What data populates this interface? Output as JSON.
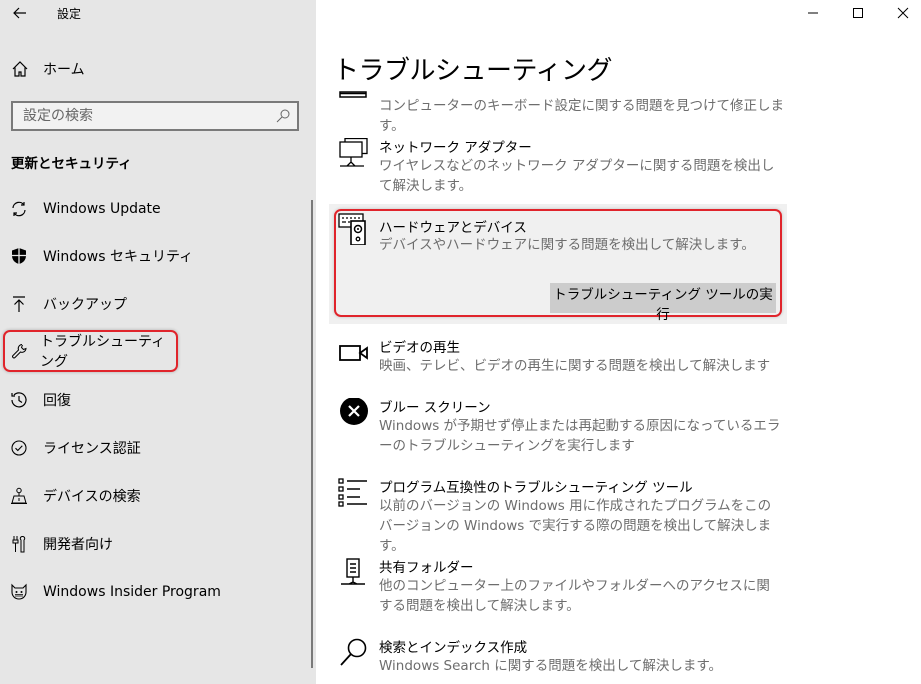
{
  "window": {
    "title": "設定",
    "controls": {
      "minimize_icon": "minimize-icon",
      "maximize_icon": "maximize-icon",
      "close_icon": "close-icon"
    }
  },
  "sidebar": {
    "home_label": "ホーム",
    "search_placeholder": "設定の検索",
    "section_heading": "更新とセキュリティ",
    "items": [
      {
        "label": "Windows Update",
        "icon": "sync-icon"
      },
      {
        "label": "Windows セキュリティ",
        "icon": "shield-icon"
      },
      {
        "label": "バックアップ",
        "icon": "backup-arrow-icon"
      },
      {
        "label": "トラブルシューティング",
        "icon": "wrench-icon",
        "active": true
      },
      {
        "label": "回復",
        "icon": "recovery-history-icon"
      },
      {
        "label": "ライセンス認証",
        "icon": "check-circle-icon"
      },
      {
        "label": "デバイスの検索",
        "icon": "find-device-icon"
      },
      {
        "label": "開発者向け",
        "icon": "developer-tools-icon"
      },
      {
        "label": "Windows Insider Program",
        "icon": "insider-cat-icon"
      }
    ]
  },
  "main": {
    "title": "トラブルシューティング",
    "troubleshooters": [
      {
        "title": "",
        "description": "コンピューターのキーボード設定に関する問題を見つけて修正します。",
        "icon": "keyboard-icon"
      },
      {
        "title": "ネットワーク アダプター",
        "description": "ワイヤレスなどのネットワーク アダプターに関する問題を検出して解決します。",
        "icon": "network-adapter-icon"
      },
      {
        "title": "ハードウェアとデバイス",
        "description": "デバイスやハードウェアに関する問題を検出して解決します。",
        "icon": "hardware-devices-icon",
        "selected": true,
        "button_label": "トラブルシューティング ツールの実行"
      },
      {
        "title": "ビデオの再生",
        "description": "映画、テレビ、ビデオの再生に関する問題を検出して解決します",
        "icon": "video-camera-icon"
      },
      {
        "title": "ブルー スクリーン",
        "description": "Windows が予期せず停止または再起動する原因になっているエラーのトラブルシューティングを実行します",
        "icon": "error-x-circle-icon"
      },
      {
        "title": "プログラム互換性のトラブルシューティング ツール",
        "description": "以前のバージョンの Windows 用に作成されたプログラムをこのバージョンの Windows で実行する際の問題を検出して解決します。",
        "icon": "program-list-icon"
      },
      {
        "title": "共有フォルダー",
        "description": "他のコンピューター上のファイルやフォルダーへのアクセスに関する問題を検出して解決します。",
        "icon": "shared-folder-icon"
      },
      {
        "title": "検索とインデックス作成",
        "description": "Windows Search に関する問題を検出して解決します。",
        "icon": "search-icon"
      }
    ]
  },
  "colors": {
    "highlight_outline": "#e0242b",
    "sidebar_bg": "#e6e6e6",
    "run_button_bg": "#cccccc"
  }
}
